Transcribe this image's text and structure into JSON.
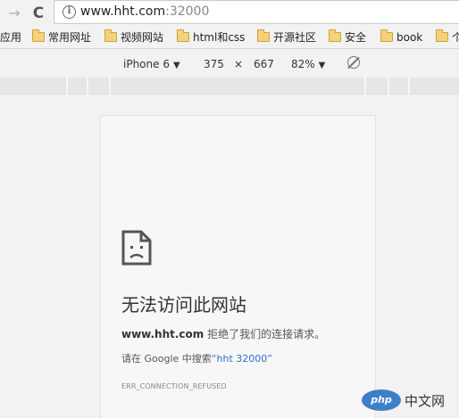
{
  "browser": {
    "url_host": "www.hht.com",
    "url_port": ":32000"
  },
  "bookmarks": [
    {
      "label": "应用",
      "folder": false
    },
    {
      "label": "常用网址",
      "folder": true
    },
    {
      "label": "视频网站",
      "folder": true
    },
    {
      "label": "html和css",
      "folder": true
    },
    {
      "label": "开源社区",
      "folder": true
    },
    {
      "label": "安全",
      "folder": true
    },
    {
      "label": "book",
      "folder": true
    },
    {
      "label": "个",
      "folder": true
    }
  ],
  "device_toolbar": {
    "device": "iPhone 6",
    "width": "375",
    "times": "×",
    "height": "667",
    "zoom": "82%"
  },
  "error_page": {
    "title": "无法访问此网站",
    "host_bold": "www.hht.com",
    "refused_text": " 拒绝了我们的连接请求。",
    "search_prefix": "请在 Google 中搜索",
    "search_link": "“hht 32000”",
    "error_code": "ERR_CONNECTION_REFUSED"
  },
  "watermark": {
    "logo": "php",
    "text": "中文网"
  }
}
